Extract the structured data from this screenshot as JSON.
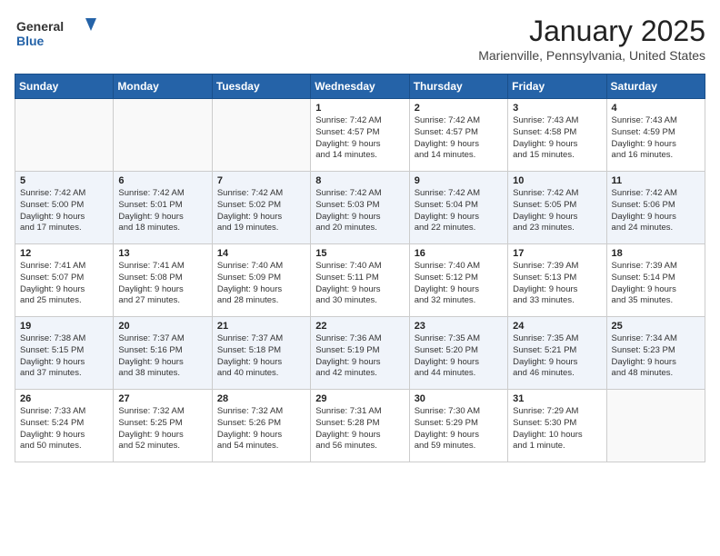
{
  "header": {
    "logo_line1": "General",
    "logo_line2": "Blue",
    "month": "January 2025",
    "location": "Marienville, Pennsylvania, United States"
  },
  "days_of_week": [
    "Sunday",
    "Monday",
    "Tuesday",
    "Wednesday",
    "Thursday",
    "Friday",
    "Saturday"
  ],
  "weeks": [
    [
      {
        "day": "",
        "info": ""
      },
      {
        "day": "",
        "info": ""
      },
      {
        "day": "",
        "info": ""
      },
      {
        "day": "1",
        "info": "Sunrise: 7:42 AM\nSunset: 4:57 PM\nDaylight: 9 hours\nand 14 minutes."
      },
      {
        "day": "2",
        "info": "Sunrise: 7:42 AM\nSunset: 4:57 PM\nDaylight: 9 hours\nand 14 minutes."
      },
      {
        "day": "3",
        "info": "Sunrise: 7:43 AM\nSunset: 4:58 PM\nDaylight: 9 hours\nand 15 minutes."
      },
      {
        "day": "4",
        "info": "Sunrise: 7:43 AM\nSunset: 4:59 PM\nDaylight: 9 hours\nand 16 minutes."
      }
    ],
    [
      {
        "day": "5",
        "info": "Sunrise: 7:42 AM\nSunset: 5:00 PM\nDaylight: 9 hours\nand 17 minutes."
      },
      {
        "day": "6",
        "info": "Sunrise: 7:42 AM\nSunset: 5:01 PM\nDaylight: 9 hours\nand 18 minutes."
      },
      {
        "day": "7",
        "info": "Sunrise: 7:42 AM\nSunset: 5:02 PM\nDaylight: 9 hours\nand 19 minutes."
      },
      {
        "day": "8",
        "info": "Sunrise: 7:42 AM\nSunset: 5:03 PM\nDaylight: 9 hours\nand 20 minutes."
      },
      {
        "day": "9",
        "info": "Sunrise: 7:42 AM\nSunset: 5:04 PM\nDaylight: 9 hours\nand 22 minutes."
      },
      {
        "day": "10",
        "info": "Sunrise: 7:42 AM\nSunset: 5:05 PM\nDaylight: 9 hours\nand 23 minutes."
      },
      {
        "day": "11",
        "info": "Sunrise: 7:42 AM\nSunset: 5:06 PM\nDaylight: 9 hours\nand 24 minutes."
      }
    ],
    [
      {
        "day": "12",
        "info": "Sunrise: 7:41 AM\nSunset: 5:07 PM\nDaylight: 9 hours\nand 25 minutes."
      },
      {
        "day": "13",
        "info": "Sunrise: 7:41 AM\nSunset: 5:08 PM\nDaylight: 9 hours\nand 27 minutes."
      },
      {
        "day": "14",
        "info": "Sunrise: 7:40 AM\nSunset: 5:09 PM\nDaylight: 9 hours\nand 28 minutes."
      },
      {
        "day": "15",
        "info": "Sunrise: 7:40 AM\nSunset: 5:11 PM\nDaylight: 9 hours\nand 30 minutes."
      },
      {
        "day": "16",
        "info": "Sunrise: 7:40 AM\nSunset: 5:12 PM\nDaylight: 9 hours\nand 32 minutes."
      },
      {
        "day": "17",
        "info": "Sunrise: 7:39 AM\nSunset: 5:13 PM\nDaylight: 9 hours\nand 33 minutes."
      },
      {
        "day": "18",
        "info": "Sunrise: 7:39 AM\nSunset: 5:14 PM\nDaylight: 9 hours\nand 35 minutes."
      }
    ],
    [
      {
        "day": "19",
        "info": "Sunrise: 7:38 AM\nSunset: 5:15 PM\nDaylight: 9 hours\nand 37 minutes."
      },
      {
        "day": "20",
        "info": "Sunrise: 7:37 AM\nSunset: 5:16 PM\nDaylight: 9 hours\nand 38 minutes."
      },
      {
        "day": "21",
        "info": "Sunrise: 7:37 AM\nSunset: 5:18 PM\nDaylight: 9 hours\nand 40 minutes."
      },
      {
        "day": "22",
        "info": "Sunrise: 7:36 AM\nSunset: 5:19 PM\nDaylight: 9 hours\nand 42 minutes."
      },
      {
        "day": "23",
        "info": "Sunrise: 7:35 AM\nSunset: 5:20 PM\nDaylight: 9 hours\nand 44 minutes."
      },
      {
        "day": "24",
        "info": "Sunrise: 7:35 AM\nSunset: 5:21 PM\nDaylight: 9 hours\nand 46 minutes."
      },
      {
        "day": "25",
        "info": "Sunrise: 7:34 AM\nSunset: 5:23 PM\nDaylight: 9 hours\nand 48 minutes."
      }
    ],
    [
      {
        "day": "26",
        "info": "Sunrise: 7:33 AM\nSunset: 5:24 PM\nDaylight: 9 hours\nand 50 minutes."
      },
      {
        "day": "27",
        "info": "Sunrise: 7:32 AM\nSunset: 5:25 PM\nDaylight: 9 hours\nand 52 minutes."
      },
      {
        "day": "28",
        "info": "Sunrise: 7:32 AM\nSunset: 5:26 PM\nDaylight: 9 hours\nand 54 minutes."
      },
      {
        "day": "29",
        "info": "Sunrise: 7:31 AM\nSunset: 5:28 PM\nDaylight: 9 hours\nand 56 minutes."
      },
      {
        "day": "30",
        "info": "Sunrise: 7:30 AM\nSunset: 5:29 PM\nDaylight: 9 hours\nand 59 minutes."
      },
      {
        "day": "31",
        "info": "Sunrise: 7:29 AM\nSunset: 5:30 PM\nDaylight: 10 hours\nand 1 minute."
      },
      {
        "day": "",
        "info": ""
      }
    ]
  ]
}
